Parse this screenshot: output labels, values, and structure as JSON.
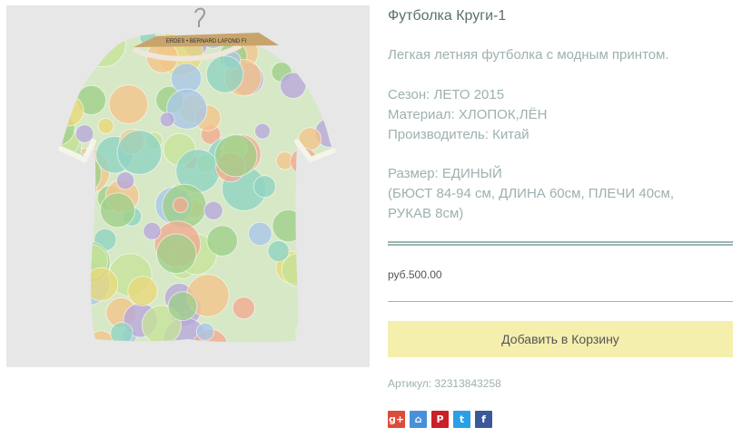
{
  "product": {
    "title": "Футболка Круги-1",
    "description": "Легкая летняя футболка с модным принтом.",
    "specs": [
      "Сезон: ЛЕТО 2015",
      "Материал: ХЛОПОК,ЛЁН",
      "Производитель: Китай"
    ],
    "size_lines": [
      "Размер: ЕДИНЫЙ",
      "(БЮСТ 84-94 см, ДЛИНА 60см, ПЛЕЧИ 40см,",
      "РУКАВ 8см)"
    ],
    "price": "руб.500.00",
    "add_to_cart_label": "Добавить в Корзину",
    "sku": "Артикул: 32313843258",
    "hanger_text": "ERDES • BERNARD LAFOND FI"
  },
  "share": [
    {
      "name": "google-plus-icon",
      "glyph": "g+",
      "color": "#dd4b39"
    },
    {
      "name": "odnoklassniki-icon",
      "glyph": "⌂",
      "color": "#4a90d9"
    },
    {
      "name": "pinterest-icon",
      "glyph": "P",
      "color": "#cb2027"
    },
    {
      "name": "twitter-icon",
      "glyph": "t",
      "color": "#2b9fe6"
    },
    {
      "name": "facebook-icon",
      "glyph": "f",
      "color": "#3b5998"
    }
  ],
  "colors": {
    "cart_button_bg": "#f5efae",
    "rule": "#9bb6b3",
    "title_text": "#5b6f6f",
    "muted_text": "#9eb0b0"
  }
}
